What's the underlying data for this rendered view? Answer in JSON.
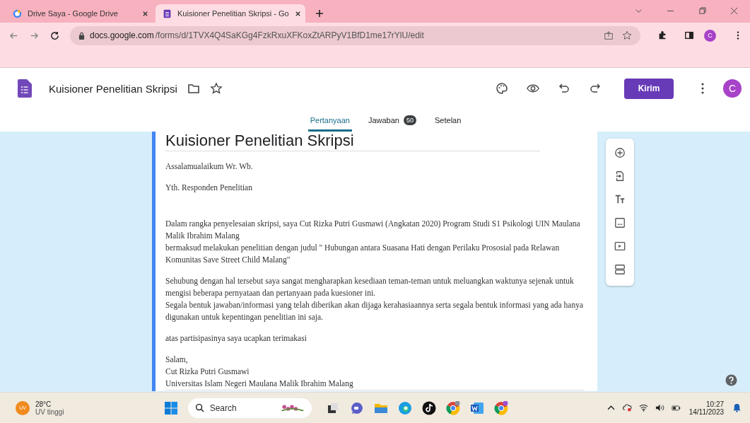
{
  "browser": {
    "tabs": [
      {
        "title": "Drive Saya - Google Drive",
        "kind": "drive",
        "selected": false
      },
      {
        "title": "Kuisioner Penelitian Skripsi - Go",
        "kind": "forms",
        "selected": true
      }
    ],
    "address": {
      "host": "docs.google.com",
      "path": "/forms/d/1TVX4Q4SaKGg4FzkRxuXFKoxZtARPyV1BfD1me17rYlU/edit"
    },
    "profile": "C"
  },
  "app": {
    "title": "Kuisioner Penelitian Skripsi",
    "send_button": "Kirim",
    "avatar": "C",
    "tabs": [
      {
        "label": "Pertanyaan",
        "selected": true
      },
      {
        "label": "Jawaban",
        "badge": "50",
        "selected": false
      },
      {
        "label": "Setelan",
        "selected": false
      }
    ]
  },
  "form": {
    "title": "Kuisioner Penelitian Skripsi",
    "paragraphs": [
      [
        "Assalamualaikum Wr. Wb."
      ],
      [
        "Yth. Responden Penelitian"
      ],
      [
        "Dalam rangka penyelesaian skripsi, saya Cut Rizka Putri Gusmawi (Angkatan 2020) Program Studi S1 Psikologi UIN Maulana Malik Ibrahim Malang",
        "bermaksud melakukan penelitian dengan judul \" Hubungan antara Suasana Hati dengan Perilaku Prososial pada Relawan Komunitas Save Street Child Malang\""
      ],
      [
        "Sehubung dengan hal tersebut saya sangat mengharapkan kesediaan teman-teman untuk meluangkan waktunya sejenak untuk mengisi beberapa pernyataan dan pertanyaan pada kuesioner ini.",
        "Segala bentuk jawaban/informasi yang telah diberikan akan dijaga kerahasiaannya serta segala bentuk informasi yang ada hanya digunakan untuk kepentingan penelitian ini saja."
      ],
      [
        "atas partisipasinya saya ucapkan terimakasi"
      ],
      [
        "Salam,",
        "Cut Rizka Putri Gusmawi",
        "Universitas Islam Negeri Maulana Malik Ibrahim Malang"
      ]
    ]
  },
  "taskbar": {
    "weather": {
      "temp": "28°C",
      "condition": "UV tinggi",
      "badge": "UV"
    },
    "search": "Search",
    "time": "10:27",
    "date": "14/11/2023"
  }
}
